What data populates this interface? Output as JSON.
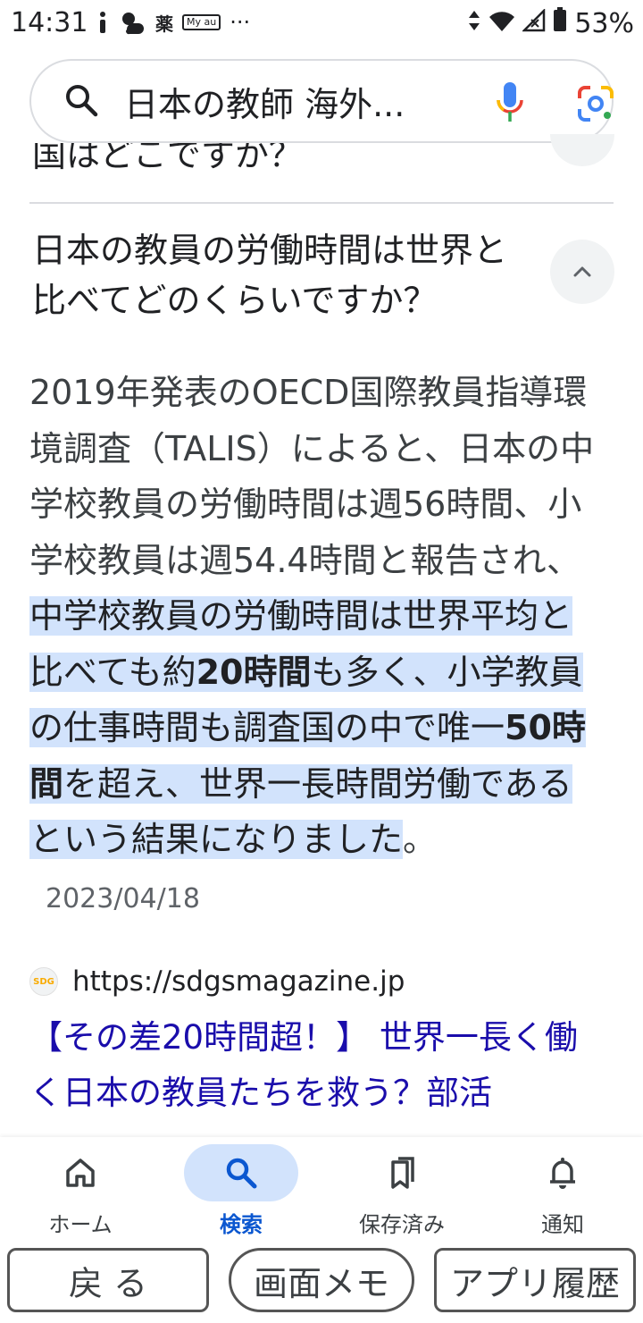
{
  "status": {
    "time": "14:31",
    "battery": "53%",
    "left_icons": [
      "info-icon",
      "weather-icon",
      "薬",
      "My au"
    ]
  },
  "search": {
    "query": "日本の教師 海外..."
  },
  "prev_question": {
    "text": "国はどこですか？"
  },
  "faq": {
    "question": "日本の教員の労働時間は世界と比べてどのくらいですか？",
    "answer": {
      "plain": "2019年発表のOECD国際教員指導環境調査（TALIS）によると、日本の中学校教員の労働時間は週56時間、小学校教員は週54.4時間と報告され、",
      "highlight_1": "中学校教員の労働時間は世界平均と比べても約",
      "bold_1": "20時間",
      "highlight_2": "も多く、小学教員の仕事時間も調査国の中で唯一",
      "bold_2": "50時間",
      "highlight_3": "を超え、世界一長時間労働であるという結果になりました",
      "tail": "。",
      "date": "2023/04/18"
    }
  },
  "source": {
    "url": "https://sdgsmagazine.jp",
    "title": "【その差20時間超！】 世界一長く働く日本の教員たちを救う？部活"
  },
  "bottom_nav": {
    "items": [
      {
        "label": "ホーム",
        "icon": "home-icon"
      },
      {
        "label": "検索",
        "icon": "search-icon",
        "active": true
      },
      {
        "label": "保存済み",
        "icon": "bookmarks-icon"
      },
      {
        "label": "通知",
        "icon": "bell-icon"
      }
    ]
  },
  "system_buttons": {
    "back": "戻 る",
    "memo": "画面メモ",
    "history": "アプリ履歴"
  },
  "colors": {
    "highlight": "#d2e3fc",
    "link": "#1a0dab",
    "active_nav": "#0b57d0"
  }
}
